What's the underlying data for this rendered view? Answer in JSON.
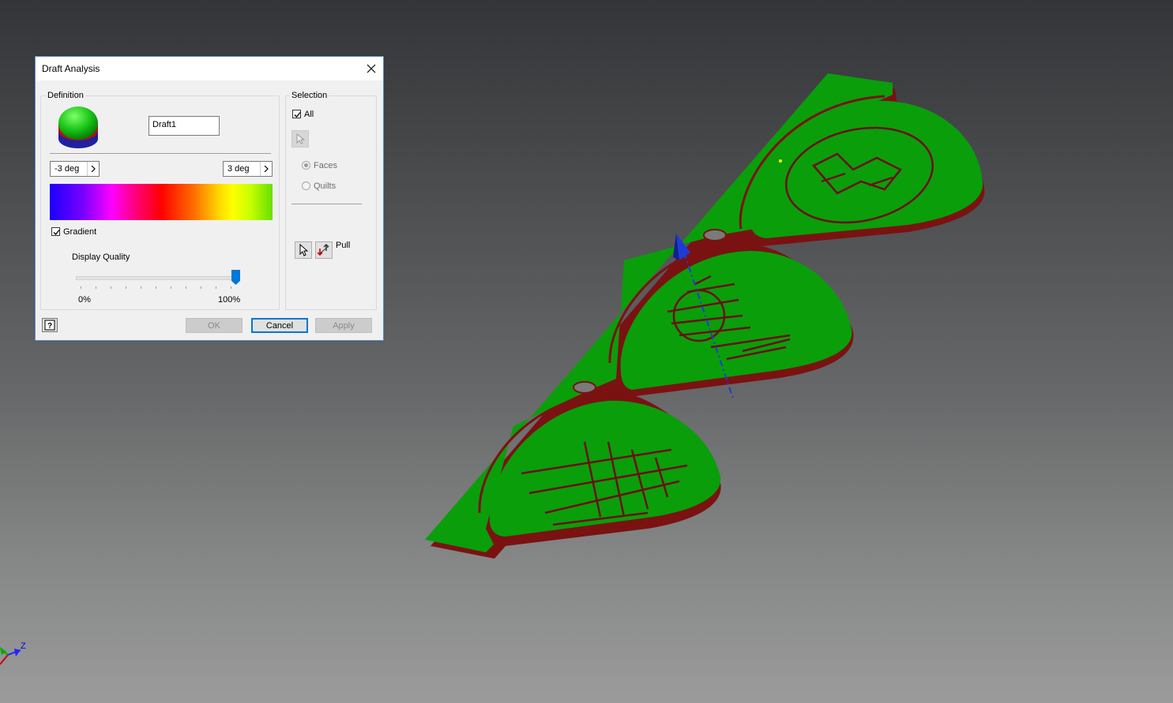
{
  "dialog": {
    "title": "Draft Analysis",
    "definition": {
      "group_label": "Definition",
      "name_value": "Draft1",
      "min_angle": "-3 deg",
      "max_angle": "3 deg",
      "gradient_label": "Gradient",
      "gradient_checked": true,
      "display_quality_label": "Display Quality",
      "quality_min_label": "0%",
      "quality_max_label": "100%",
      "quality_value_percent": 100
    },
    "selection": {
      "group_label": "Selection",
      "all_label": "All",
      "all_checked": true,
      "faces_label": "Faces",
      "quilts_label": "Quilts",
      "pull_label": "Pull"
    },
    "buttons": {
      "ok": "OK",
      "cancel": "Cancel",
      "apply": "Apply"
    }
  },
  "viewport": {
    "model_color": "#0a9e0a",
    "edge_color": "#7a1010",
    "pull_axis_color": "#1f3bd6",
    "triad_label": "Z"
  }
}
